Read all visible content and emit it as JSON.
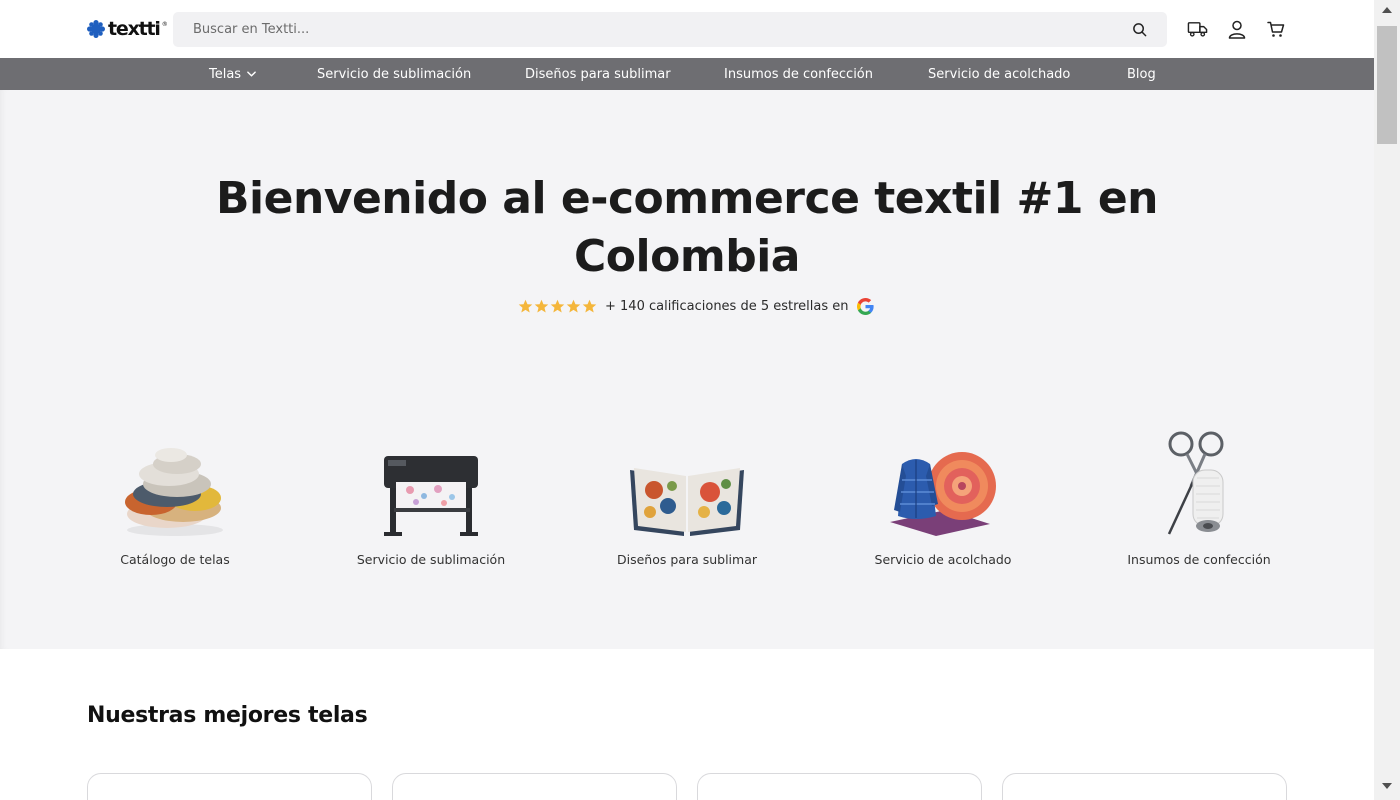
{
  "brand": {
    "name": "textti",
    "trademark": "®"
  },
  "search": {
    "placeholder": "Buscar en Textti..."
  },
  "header_icons": [
    "truck-icon",
    "user-icon",
    "cart-icon"
  ],
  "nav": {
    "items": [
      {
        "label": "Telas",
        "has_dropdown": true
      },
      {
        "label": "Servicio de sublimación"
      },
      {
        "label": "Diseños para sublimar"
      },
      {
        "label": "Insumos de confección"
      },
      {
        "label": "Servicio de acolchado"
      },
      {
        "label": "Blog"
      }
    ]
  },
  "hero": {
    "title_line1": "Bienvenido al e-commerce textil #1 en",
    "title_line2": "Colombia",
    "rating": {
      "stars": 5,
      "text": "+ 140 calificaciones de 5 estrellas en"
    }
  },
  "categories": [
    {
      "label": "Catálogo de telas"
    },
    {
      "label": "Servicio de sublimación"
    },
    {
      "label": "Diseños para sublimar"
    },
    {
      "label": "Servicio de acolchado"
    },
    {
      "label": "Insumos de confección"
    }
  ],
  "best_fabrics": {
    "title": "Nuestras mejores telas"
  },
  "colors": {
    "nav_bg": "#6e6e72",
    "hero_bg": "#f4f4f6",
    "star": "#f4b63b",
    "search_bg": "#f1f1f3"
  }
}
